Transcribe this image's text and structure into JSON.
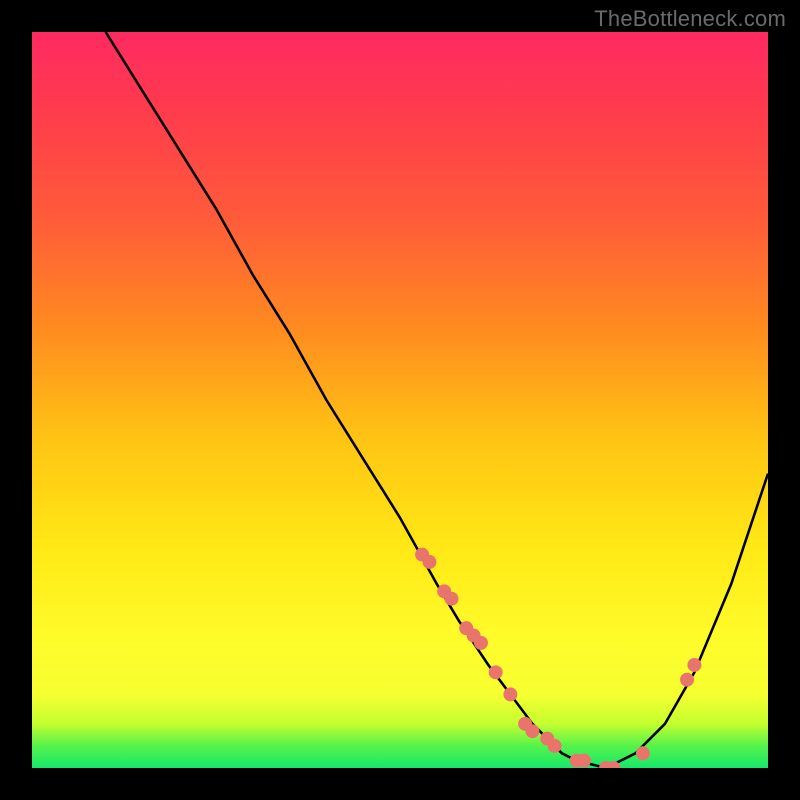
{
  "watermark": "TheBottleneck.com",
  "chart_data": {
    "type": "line",
    "title": "",
    "xlabel": "",
    "ylabel": "",
    "xlim": [
      0,
      100
    ],
    "ylim": [
      0,
      100
    ],
    "series": [
      {
        "name": "bottleneck-curve",
        "x": [
          10,
          15,
          20,
          25,
          30,
          35,
          40,
          45,
          50,
          55,
          58,
          62,
          65,
          68,
          70,
          72,
          74,
          78,
          82,
          86,
          90,
          95,
          100
        ],
        "y": [
          100,
          92,
          84,
          76,
          67,
          59,
          50,
          42,
          34,
          25,
          20,
          14,
          10,
          6,
          4,
          2,
          1,
          0,
          2,
          6,
          13,
          25,
          40
        ]
      }
    ],
    "highlight_points": {
      "name": "marked-configs",
      "color": "#e9746c",
      "x": [
        53,
        54,
        56,
        57,
        59,
        60,
        61,
        63,
        65,
        67,
        68,
        70,
        71,
        74,
        75,
        78,
        79,
        83,
        89,
        90
      ],
      "y": [
        29,
        28,
        24,
        23,
        19,
        18,
        17,
        13,
        10,
        6,
        5,
        4,
        3,
        1,
        1,
        0,
        0,
        2,
        12,
        14
      ]
    }
  }
}
